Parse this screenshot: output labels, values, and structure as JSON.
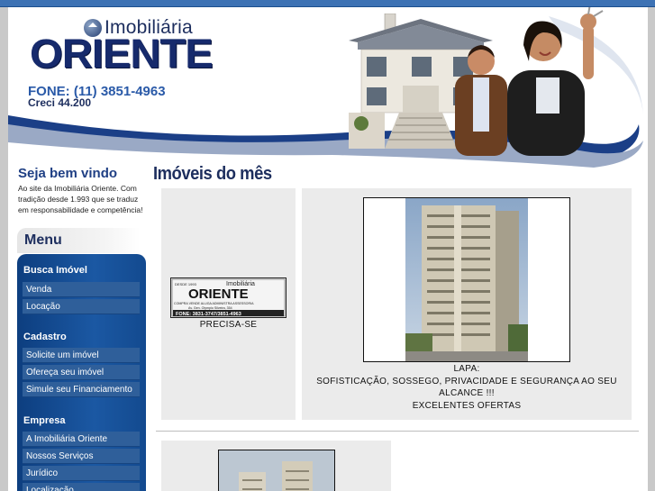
{
  "header": {
    "logo_small": "Imobiliária",
    "logo_big": "ORIENTE",
    "phone": "FONE: (11) 3851-4963",
    "creci": "Creci  44.200"
  },
  "welcome": {
    "title": "Seja bem vindo",
    "text": "Ao site da Imobiliária Oriente. Com tradição desde 1.993 que se traduz em responsabilidade e competência!"
  },
  "menu": {
    "title": "Menu",
    "sections": [
      {
        "title": "Busca Imóvel",
        "items": [
          "Venda",
          "Locação"
        ]
      },
      {
        "title": "Cadastro",
        "items": [
          "Solicite um imóvel",
          "Ofereça seu imóvel",
          "Simule seu Financiamento"
        ]
      },
      {
        "title": "Empresa",
        "items": [
          "A Imobiliária Oriente",
          "Nossos Serviços",
          "Jurídico",
          "Localização"
        ]
      }
    ]
  },
  "main": {
    "title": "Imóveis do mês",
    "cards": [
      {
        "caption": "PRECISA-SE",
        "sign": {
          "top_left": "DESDE 1993",
          "brand_small": "Imobiliária",
          "brand_big": "ORIENTE",
          "line1": "COMPRA VENDE ALUGA ADMINISTRA ASSESSORIA",
          "line2": "Av. Gen. Olympio Silveira, 354",
          "phone": "FONE: 3831-3747/3851-4963"
        }
      },
      {
        "caption_line1": "LAPA:",
        "caption_line2": "SOFISTICAÇÃO, SOSSEGO, PRIVACIDADE E SEGURANÇA AO SEU",
        "caption_line3": "ALCANCE !!!",
        "caption_line4": "EXCELENTES OFERTAS"
      }
    ]
  },
  "colors": {
    "brand_navy": "#1d2e5e",
    "menu_blue": "#1b58a3",
    "top_bar": "#3d72b4"
  }
}
